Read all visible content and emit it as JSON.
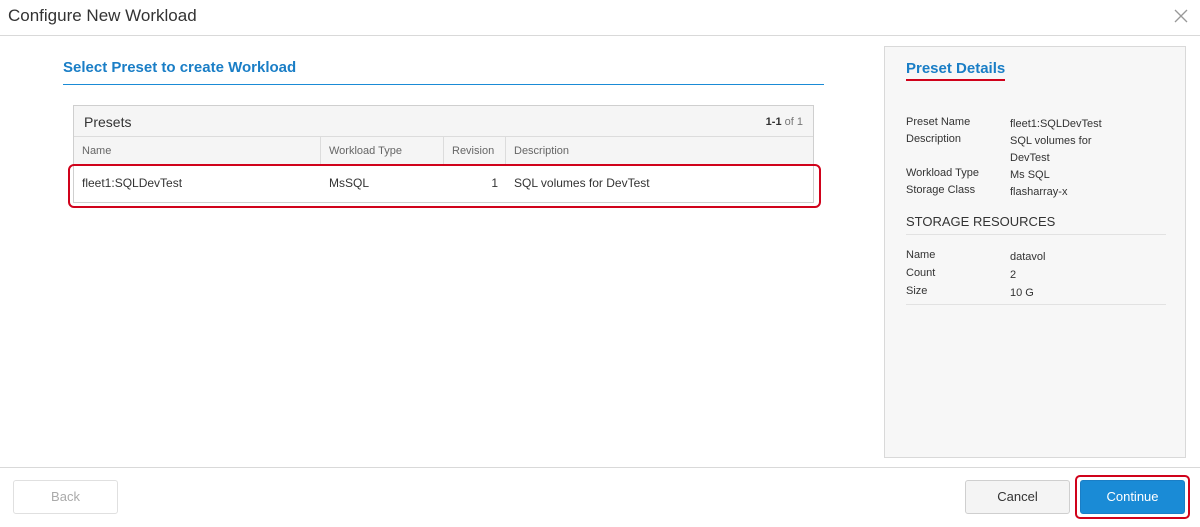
{
  "dialog": {
    "title": "Configure New Workload",
    "close_icon": "close-icon"
  },
  "main": {
    "section_title": "Select Preset to create Workload",
    "presets": {
      "label": "Presets",
      "pagination_range": "1-1",
      "pagination_of": "of 1",
      "columns": [
        "Name",
        "Workload Type",
        "Revision",
        "Description"
      ],
      "rows": [
        {
          "name": "fleet1:SQLDevTest",
          "workload_type": "MsSQL",
          "revision": "1",
          "description": "SQL volumes for DevTest"
        }
      ]
    }
  },
  "details": {
    "title": "Preset Details",
    "fields": [
      {
        "label": "Preset Name",
        "value": "fleet1:SQLDevTest"
      },
      {
        "label": "Description",
        "value": "SQL volumes for DevTest"
      },
      {
        "label": "Workload Type",
        "value": "Ms SQL"
      },
      {
        "label": "Storage Class",
        "value": "flasharray-x"
      }
    ],
    "storage_resources_title": "STORAGE RESOURCES",
    "resources": [
      {
        "label": "Name",
        "value": "datavol"
      },
      {
        "label": "Count",
        "value": "2"
      },
      {
        "label": "Size",
        "value": "10 G"
      }
    ]
  },
  "footer": {
    "back_label": "Back",
    "cancel_label": "Cancel",
    "continue_label": "Continue"
  },
  "colors": {
    "accent": "#1a8bd6",
    "highlight": "#d0021b"
  }
}
